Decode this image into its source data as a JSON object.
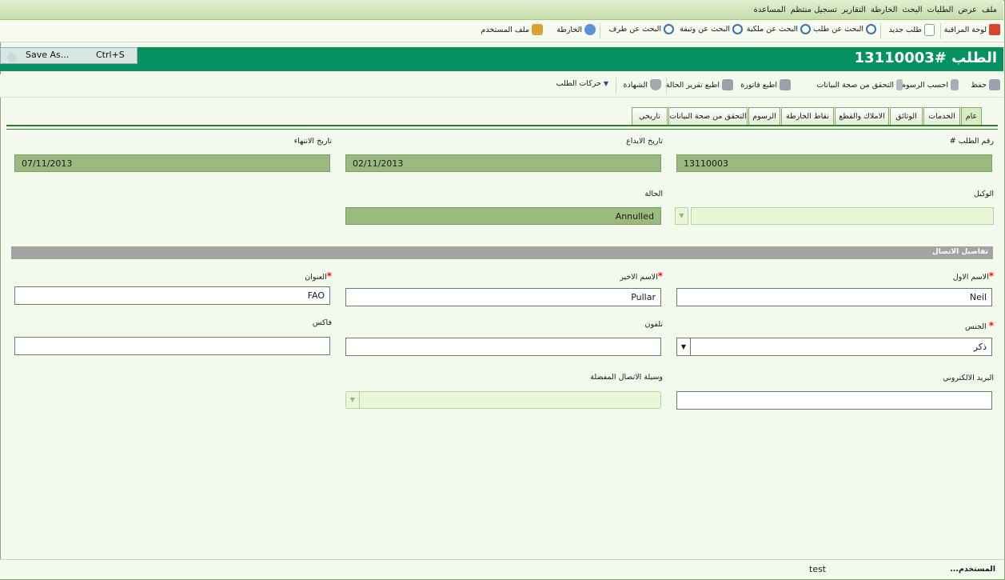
{
  "menu": [
    "ملف",
    "عرض",
    "الطلبات",
    "البحث",
    "الخارطة",
    "التقارير",
    "تسجيل منتظم",
    "المساعدة"
  ],
  "toolbar1": {
    "dashboard": "لوحة المراقبة",
    "new_request": "طلب جديد",
    "search_request": "البحث عن طلب",
    "search_property": "البحث عن ملكية",
    "search_document": "البحث عن وثيقة",
    "search_party": "البحث عن طرف",
    "map": "الخارطة",
    "user_profile": "ملف المستخدم"
  },
  "save_as": {
    "label": "Save As...",
    "shortcut": "Ctrl+S"
  },
  "title": "الطلب #13110003",
  "toolbar2": {
    "save": "حفظ",
    "calc_fees": "احسب الرسوم",
    "validate": "التحقق من صحة البيانات",
    "print_invoice": "اطبع فاتورة",
    "print_status": "اطبع تقرير الحالة",
    "certificate": "الشهادة",
    "request_actions": "حركات الطلب"
  },
  "tabs": [
    "عام",
    "الخدمات",
    "الوثائق",
    "الاملاك والقطع",
    "نقاط الخارطة",
    "الرسوم",
    "التحقق من صحة البيانات",
    "تاريخي"
  ],
  "fields": {
    "request_no_label": "رقم الطلب #",
    "request_no": "13110003",
    "lodged_label": "تاريخ الايداع",
    "lodged": "02/11/2013",
    "expiry_label": "تاريخ الانتهاء",
    "expiry": "07/11/2013",
    "agent_label": "الوكيل",
    "status_label": "الحالة",
    "status": "Annulled"
  },
  "section_title": "تفاصيل الاتصال",
  "contact": {
    "first_name_label": "الاسم الاول",
    "first_name": "Neil",
    "last_name_label": "الاسم الاخير",
    "last_name": "Pullar",
    "address_label": "العنوان",
    "address": "FAO",
    "gender_label": "الجنس",
    "gender": "ذكر",
    "phone_label": "تلفون",
    "fax_label": "فاكس",
    "email_label": "البريد الالكتروني",
    "preferred_label": "وسيلة الاتصال المفضلة"
  },
  "status_bar": {
    "label": "المستخدم...",
    "value": "test"
  }
}
